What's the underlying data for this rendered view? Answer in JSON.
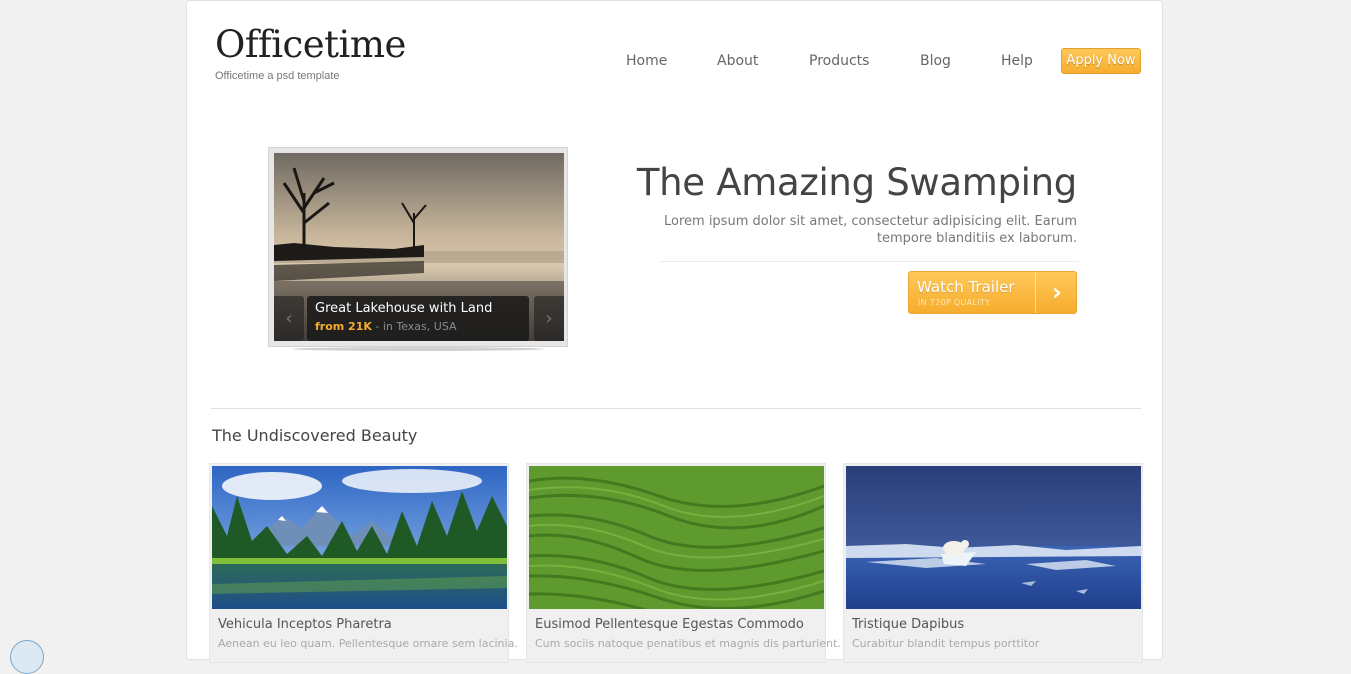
{
  "brand": {
    "title": "Officetime",
    "tagline": "Officetime a psd template"
  },
  "nav": {
    "items": [
      {
        "label": "Home"
      },
      {
        "label": "About"
      },
      {
        "label": "Products"
      },
      {
        "label": "Blog"
      },
      {
        "label": "Help"
      }
    ],
    "cta_label": "Apply Now"
  },
  "slider": {
    "caption_title": "Great Lakehouse with Land",
    "caption_price": "from 21K",
    "caption_location": " - in Texas, USA",
    "prev_icon": "chevron-left-icon",
    "next_icon": "chevron-right-icon"
  },
  "hero": {
    "title": "The Amazing Swamping",
    "description": "Lorem ipsum dolor sit amet, consectetur adipisicing elit. Earum tempore blanditiis ex laborum.",
    "button_label": "Watch Trailer",
    "button_sublabel": "IN 720P QUALITY",
    "button_icon": "chevron-right-icon"
  },
  "section": {
    "title": "The Undiscovered Beauty",
    "cards": [
      {
        "title": "Vehicula Inceptos Pharetra",
        "desc": "Aenean eu leo quam. Pellentesque ornare sem lacinia."
      },
      {
        "title": "Eusimod Pellentesque Egestas Commodo",
        "desc": "Cum sociis natoque penatibus et magnis dis parturient."
      },
      {
        "title": "Tristique Dapibus",
        "desc": "Curabitur blandit tempus porttitor"
      }
    ]
  },
  "colors": {
    "accent": "#f6ad2d",
    "page_bg": "#f1f1f1",
    "text": "#555555"
  }
}
